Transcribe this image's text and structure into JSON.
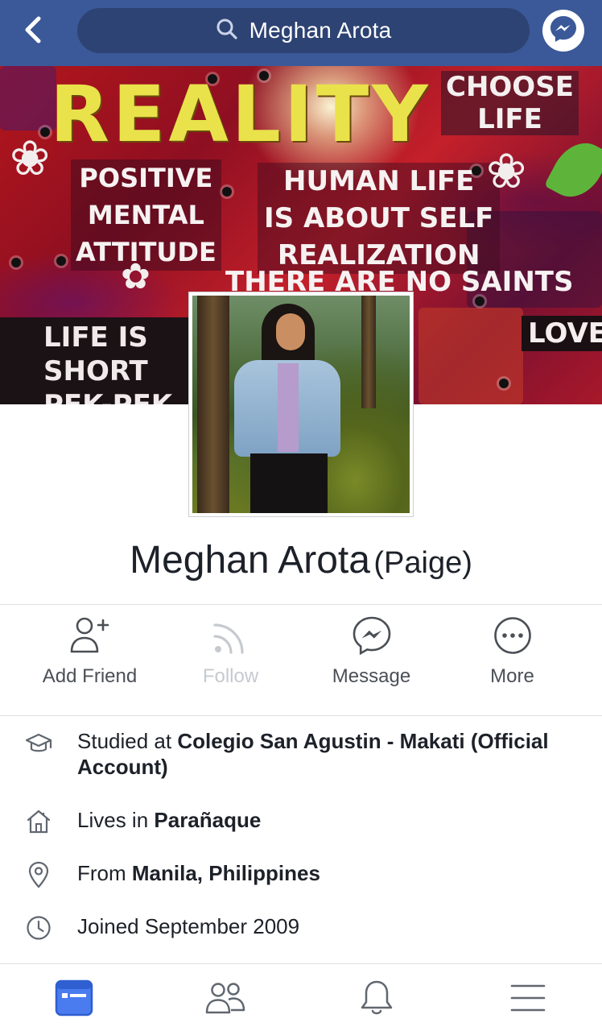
{
  "header": {
    "search_text": "Meghan Arota",
    "back_icon": "chevron-left-icon",
    "messenger_icon": "messenger-icon",
    "accent_color": "#3b5998"
  },
  "cover": {
    "reality": "REALITY",
    "choose_life": [
      "CHOOSE",
      "LIFE"
    ],
    "positive": [
      "POSITIVE",
      "MENTAL",
      "ATTITUDE"
    ],
    "human": [
      "HUMAN LIFE",
      "IS ABOUT SELF",
      "REALIZATION"
    ],
    "saints": "THERE ARE NO SAINTS",
    "life_short": [
      "LIFE IS",
      "SHORT",
      "PEK-PEK"
    ],
    "love": "LOVE"
  },
  "profile": {
    "name": "Meghan Arota",
    "alt_name": "(Paige)"
  },
  "actions": [
    {
      "label": "Add Friend",
      "icon": "add-friend-icon",
      "enabled": true
    },
    {
      "label": "Follow",
      "icon": "follow-icon",
      "enabled": false
    },
    {
      "label": "Message",
      "icon": "messenger-icon",
      "enabled": true
    },
    {
      "label": "More",
      "icon": "more-icon",
      "enabled": true
    }
  ],
  "info": {
    "studied": {
      "prefix": "Studied at ",
      "value": "Colegio San Agustin - Makati (Official Account)",
      "icon": "graduation-cap-icon"
    },
    "lives": {
      "prefix": "Lives in ",
      "value": "Parañaque",
      "icon": "home-icon"
    },
    "from": {
      "prefix": "From ",
      "value": "Manila, Philippines",
      "icon": "location-pin-icon"
    },
    "joined": {
      "prefix": "Joined September 2009",
      "icon": "clock-icon"
    }
  },
  "bottom_nav": [
    {
      "name": "news-feed",
      "icon": "news-feed-icon",
      "active": true
    },
    {
      "name": "friends",
      "icon": "friends-icon",
      "active": false
    },
    {
      "name": "notifications",
      "icon": "bell-icon",
      "active": false
    },
    {
      "name": "menu",
      "icon": "menu-icon",
      "active": false
    }
  ]
}
